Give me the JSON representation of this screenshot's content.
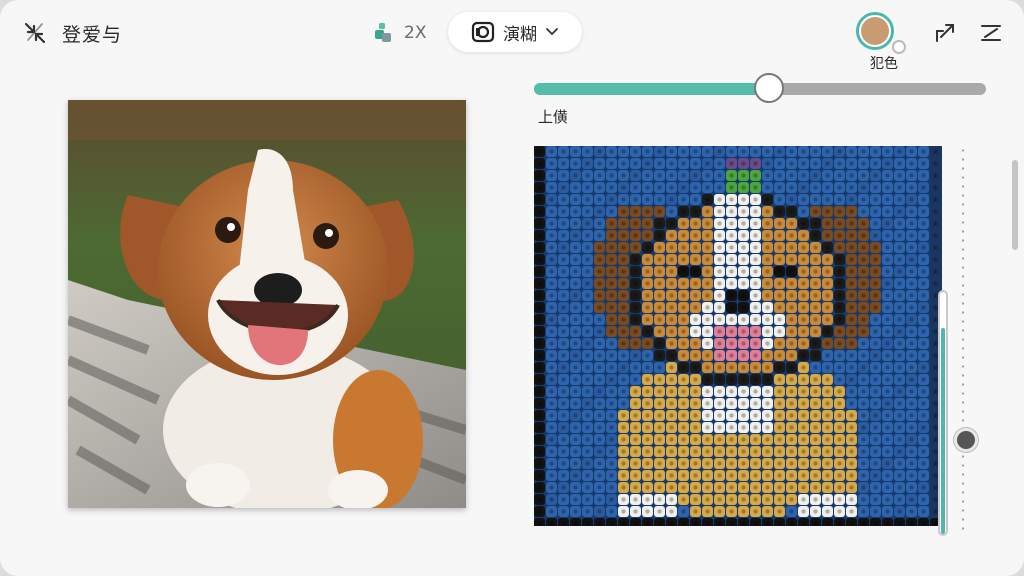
{
  "header": {
    "title": "登爱与",
    "multiplier": "2X",
    "mode_label": "演糊",
    "color_label": "犯色"
  },
  "slider": {
    "label": "上僙",
    "value_fraction": 0.52
  },
  "vertical_slider": {
    "value_fraction": 0.85
  },
  "colors": {
    "accent": "#55bca9",
    "swatch": "#c99b72",
    "pixel_background": "#1f4f8f"
  },
  "icons": {
    "back": "collapse-arrows-icon",
    "multiplier": "cube-stack-icon",
    "mode": "camera-lens-icon",
    "dropdown": "chevron-down-icon",
    "share": "share-arrow-icon",
    "menu": "menu-icon"
  }
}
